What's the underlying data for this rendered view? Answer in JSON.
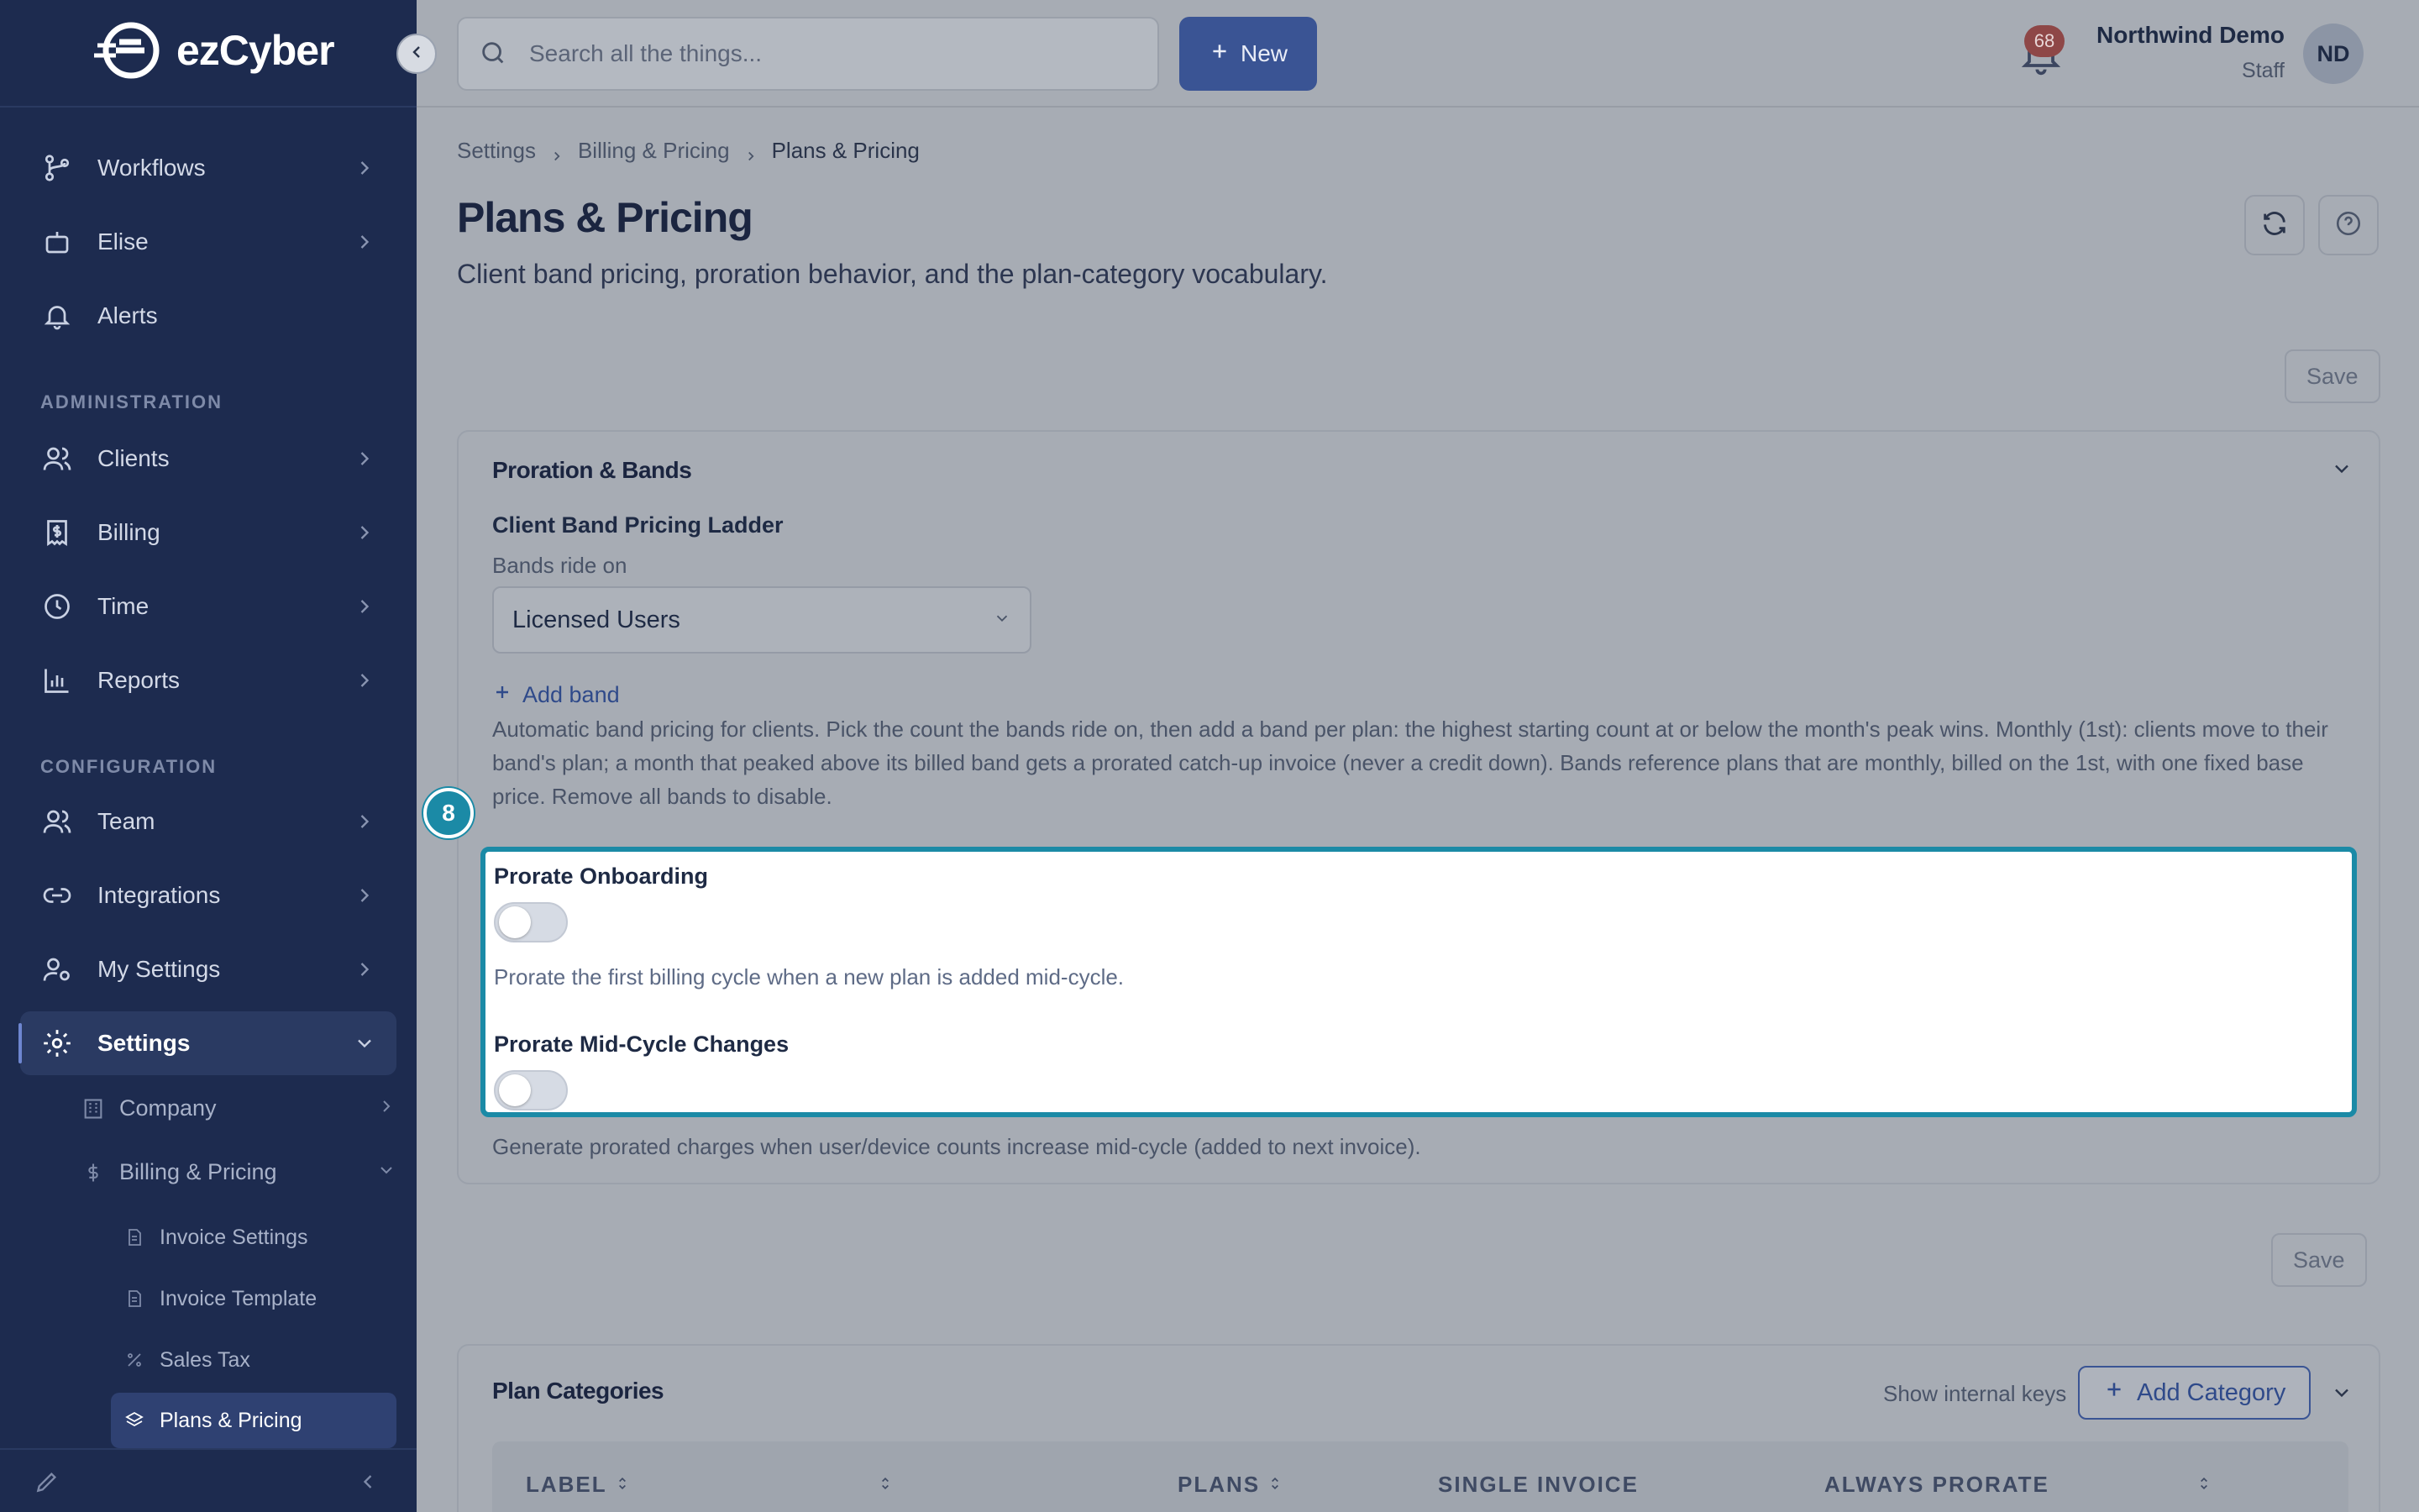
{
  "app": {
    "brand": "ezCyber"
  },
  "search": {
    "placeholder": "Search all the things..."
  },
  "topbar": {
    "new_label": "New",
    "notification_count": "68"
  },
  "user": {
    "name": "Northwind Demo",
    "role": "Staff",
    "initials": "ND"
  },
  "sidebar": {
    "items": [
      {
        "label": "Workflows",
        "icon": "workflow-icon"
      },
      {
        "label": "Elise",
        "icon": "bot-icon"
      },
      {
        "label": "Alerts",
        "icon": "bell-icon"
      },
      {
        "label": "Clients",
        "icon": "users-icon"
      },
      {
        "label": "Billing",
        "icon": "receipt-icon"
      },
      {
        "label": "Time",
        "icon": "clock-icon"
      },
      {
        "label": "Reports",
        "icon": "chart-icon"
      },
      {
        "label": "Team",
        "icon": "team-icon"
      },
      {
        "label": "Integrations",
        "icon": "link-icon"
      },
      {
        "label": "My Settings",
        "icon": "user-gear-icon"
      },
      {
        "label": "Settings",
        "icon": "gear-icon"
      }
    ],
    "sections": {
      "administration": "ADMINISTRATION",
      "configuration": "CONFIGURATION"
    },
    "sub": {
      "company": "Company",
      "billing_pricing": "Billing & Pricing"
    },
    "subsub": [
      {
        "label": "Invoice Settings"
      },
      {
        "label": "Invoice Template"
      },
      {
        "label": "Sales Tax"
      },
      {
        "label": "Plans & Pricing"
      }
    ]
  },
  "breadcrumb": [
    "Settings",
    "Billing & Pricing",
    "Plans & Pricing"
  ],
  "page": {
    "title": "Plans & Pricing",
    "subtitle": "Client band pricing, proration behavior, and the plan-category vocabulary.",
    "save_label": "Save"
  },
  "proration": {
    "title": "Proration & Bands",
    "ladder_label": "Client Band Pricing Ladder",
    "bands_ride_label": "Bands ride on",
    "bands_ride_value": "Licensed Users",
    "add_band": "Add band",
    "help": "Automatic band pricing for clients. Pick the count the bands ride on, then add a band per plan: the highest starting count at or below the month's peak wins. Monthly (1st): clients move to their band's plan; a month that peaked above its billed band gets a prorated catch-up invoice (never a credit down). Bands reference plans that are monthly, billed on the 1st, with one fixed base price. Remove all bands to disable.",
    "step": "8",
    "onboarding_label": "Prorate Onboarding",
    "onboarding_on": false,
    "onboarding_help": "Prorate the first billing cycle when a new plan is added mid-cycle.",
    "midcycle_label": "Prorate Mid-Cycle Changes",
    "midcycle_on": false,
    "midcycle_help": "Generate prorated charges when user/device counts increase mid-cycle (added to next invoice)."
  },
  "categories": {
    "title": "Plan Categories",
    "show_keys": "Show internal keys",
    "add_label": "Add Category",
    "columns": [
      "LABEL",
      "PLANS",
      "SINGLE INVOICE",
      "ALWAYS PRORATE"
    ]
  },
  "colors": {
    "sidebar": "#1d2b4f",
    "accent": "#3a5494",
    "highlight": "#1b8aa6"
  }
}
